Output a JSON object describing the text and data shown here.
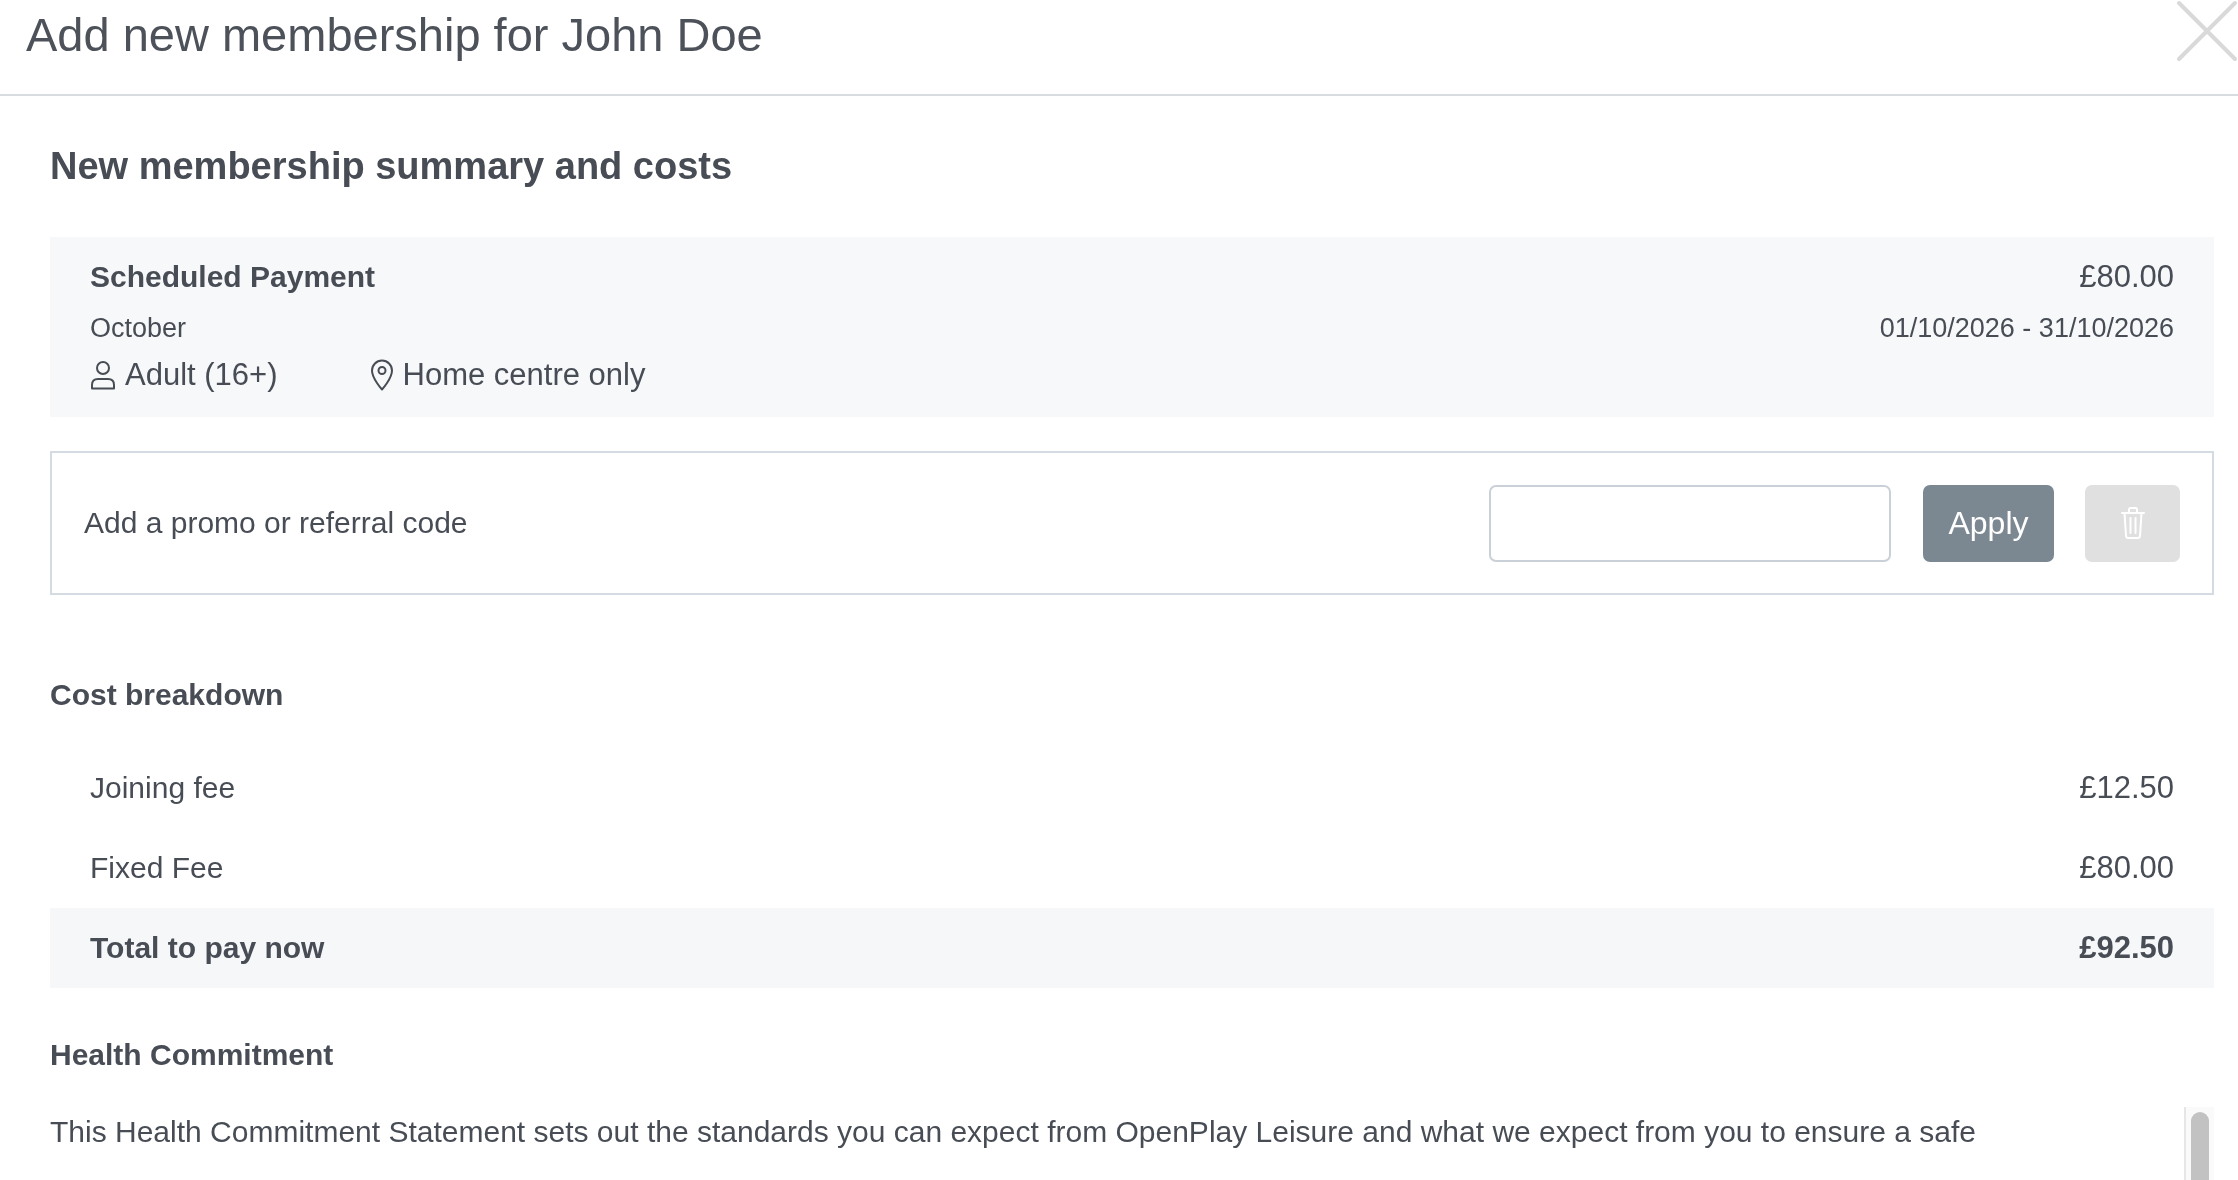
{
  "dialog": {
    "title": "Add new membership for John Doe"
  },
  "summary": {
    "heading": "New membership summary and costs",
    "scheduled_payment": {
      "title": "Scheduled Payment",
      "amount": "£80.00",
      "period": "October",
      "date_range": "01/10/2026 - 31/10/2026",
      "attributes": [
        {
          "kind": "audience",
          "label": "Adult (16+)"
        },
        {
          "kind": "location",
          "label": "Home centre only"
        }
      ]
    }
  },
  "promo": {
    "label": "Add a promo or referral code",
    "apply_button": "Apply",
    "remove_button": {
      "disabled": true
    }
  },
  "cost_breakdown": {
    "heading": "Cost breakdown",
    "rows": [
      {
        "kind": "line",
        "label": "Joining fee",
        "amount": "£12.50"
      },
      {
        "kind": "line",
        "label": "Fixed Fee",
        "amount": "£80.00"
      },
      {
        "kind": "total",
        "label": "Total to pay now",
        "amount": "£92.50"
      }
    ]
  },
  "health_commitment": {
    "heading": "Health Commitment",
    "text": "This Health Commitment Statement sets out the standards you can expect from OpenPlay Leisure and what we expect from you to ensure a safe"
  }
}
